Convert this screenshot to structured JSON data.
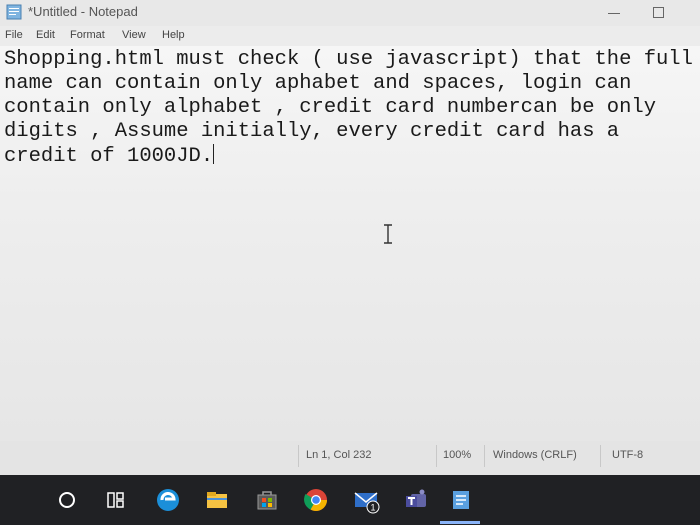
{
  "window": {
    "title": "*Untitled - Notepad",
    "icon": "notepad-icon"
  },
  "menu": {
    "items": [
      "File",
      "Edit",
      "Format",
      "View",
      "Help"
    ]
  },
  "editor": {
    "text": "Shopping.html must check ( use javascript) that the full name can contain only aphabet and spaces, login can contain only alphabet , credit card numbercan be only digits , Assume initially, every credit card has a credit of 1000JD."
  },
  "status": {
    "position": "Ln 1, Col 232",
    "zoom": "100%",
    "line_ending": "Windows (CRLF)",
    "encoding": "UTF-8"
  },
  "taskbar": {
    "icons": [
      "cortana-circle-icon",
      "task-view-icon",
      "edge-icon",
      "file-explorer-icon",
      "store-icon",
      "chrome-icon",
      "mail-icon",
      "teams-icon",
      "notepad-icon"
    ],
    "mail_badge": "1"
  }
}
